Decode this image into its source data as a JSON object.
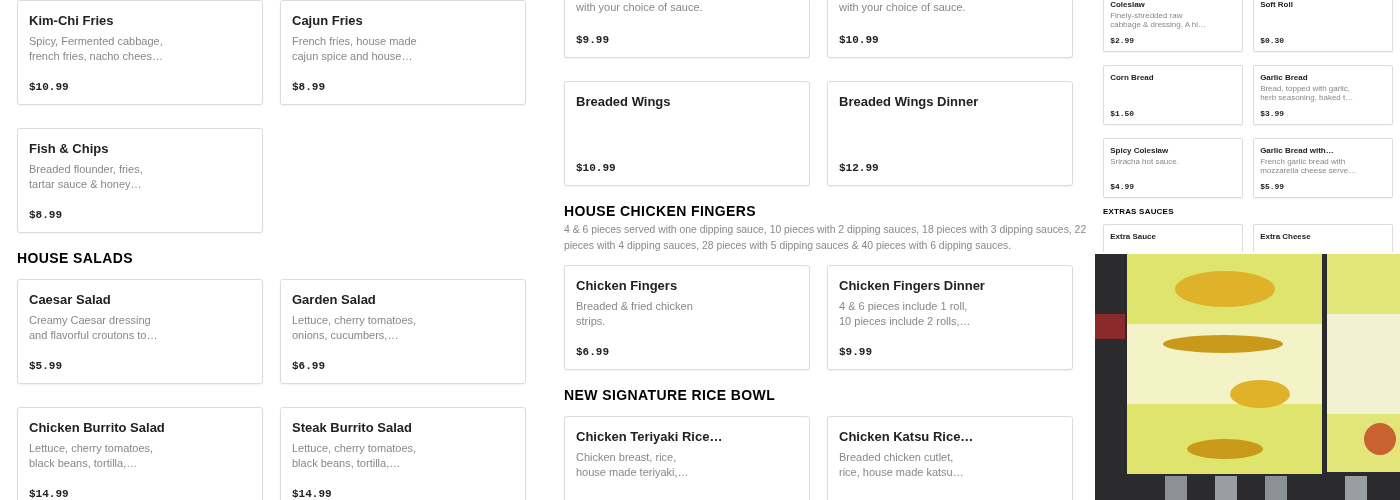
{
  "panels": [
    {
      "kind": "full",
      "sections": [
        {
          "items": [
            {
              "name": "Kim-Chi Fries",
              "description": [
                "Spicy, Fermented cabbage,",
                "french fries, nacho chees…"
              ],
              "price": "$10.99"
            },
            {
              "name": "Cajun Fries",
              "description": [
                "French fries, house made",
                "cajun spice and house…"
              ],
              "price": "$8.99"
            },
            {
              "name": "Fish & Chips",
              "description": [
                "Breaded flounder, fries,",
                "tartar sauce & honey…"
              ],
              "price": "$8.99"
            }
          ]
        },
        {
          "title": "HOUSE SALADS",
          "items": [
            {
              "name": "Caesar Salad",
              "description": [
                "Creamy Caesar dressing",
                "and flavorful croutons to…"
              ],
              "price": "$5.99"
            },
            {
              "name": "Garden Salad",
              "description": [
                "Lettuce, cherry tomatoes,",
                "onions, cucumbers,…"
              ],
              "price": "$6.99"
            },
            {
              "name": "Chicken Burrito Salad",
              "description": [
                "Lettuce, cherry tomatoes,",
                "black beans, tortilla,…"
              ],
              "price": "$14.99"
            },
            {
              "name": "Steak Burrito Salad",
              "description": [
                "Lettuce, cherry tomatoes,",
                "black beans, tortilla,…"
              ],
              "price": "$14.99"
            }
          ]
        }
      ]
    },
    {
      "kind": "full",
      "sections": [
        {
          "items": [
            {
              "cut_top": true,
              "description": [
                "with your choice of sauce."
              ],
              "price": "$9.99"
            },
            {
              "cut_top": true,
              "description": [
                "with your choice of sauce."
              ],
              "price": "$10.99"
            },
            {
              "name": "Breaded Wings",
              "price": "$10.99"
            },
            {
              "name": "Breaded Wings Dinner",
              "price": "$12.99"
            }
          ]
        },
        {
          "title": "HOUSE CHICKEN FINGERS",
          "description": "4 & 6 pieces served with one dipping sauce, 10 pieces with 2 dipping sauces, 18 pieces with 3 dipping sauces, 22 pieces with 4 dipping sauces, 28 pieces with 5 dipping sauces & 40 pieces with 6 dipping sauces.",
          "items": [
            {
              "name": "Chicken Fingers",
              "description": [
                "Breaded & fried chicken",
                "strips."
              ],
              "price": "$6.99"
            },
            {
              "name": "Chicken Fingers Dinner",
              "description": [
                "4 & 6 pieces include 1 roll,",
                "10 pieces include 2 rolls,…"
              ],
              "price": "$9.99"
            }
          ]
        },
        {
          "title": "NEW SIGNATURE RICE BOWL",
          "items": [
            {
              "name": "Chicken Teriyaki Rice…",
              "description": [
                "Chicken breast, rice,",
                "house made teriyaki,…"
              ]
            },
            {
              "name": "Chicken Katsu Rice…",
              "description": [
                "Breaded chicken cutlet,",
                "rice, house made katsu…"
              ]
            }
          ]
        }
      ]
    },
    {
      "kind": "compact",
      "sections": [
        {
          "items": [
            {
              "name": "Coleslaw",
              "description": [
                "Finely-shredded raw",
                "cabbage & dressing. A hi…"
              ],
              "price": "$2.99"
            },
            {
              "name": "Soft Roll",
              "price": "$0.30"
            },
            {
              "name": "Corn Bread",
              "price": "$1.50"
            },
            {
              "name": "Garlic Bread",
              "description": [
                "Bread, topped with garlic,",
                "herb seasoning, baked t…"
              ],
              "price": "$3.99"
            },
            {
              "name": "Spicy Coleslaw",
              "description": [
                "Sriracha hot sauce."
              ],
              "price": "$4.99"
            },
            {
              "name": "Garlic Bread with…",
              "description": [
                "French garlic bread with",
                "mozzarella cheese serve…"
              ],
              "price": "$5.99"
            }
          ]
        },
        {
          "title": "EXTRAS SAUCES",
          "items": [
            {
              "name": "Extra Sauce"
            },
            {
              "name": "Extra Cheese"
            }
          ]
        }
      ]
    }
  ]
}
